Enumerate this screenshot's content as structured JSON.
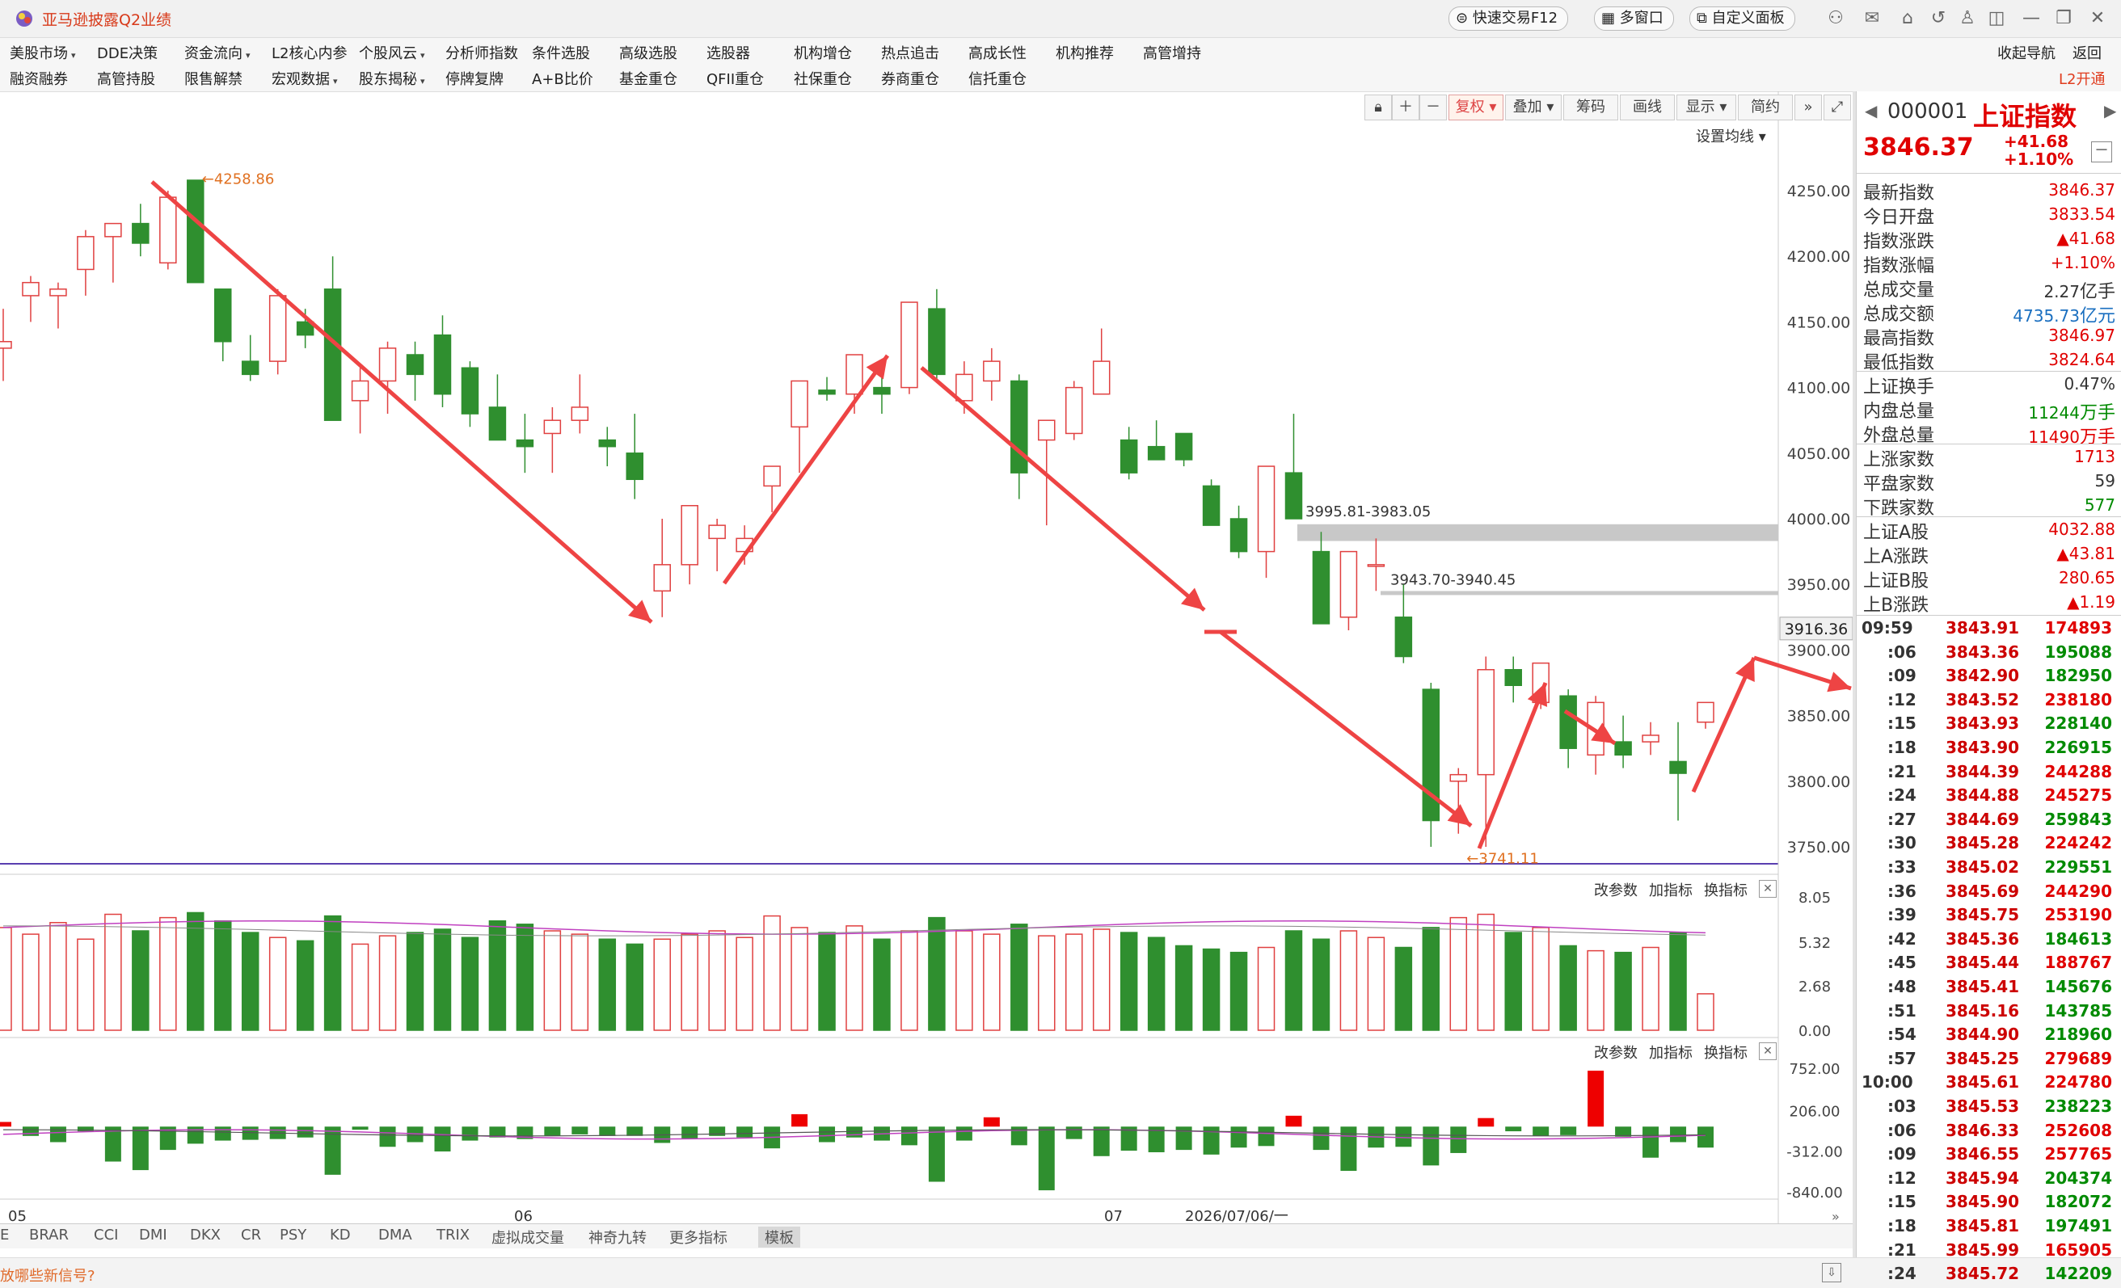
{
  "app": {
    "title": "亚马逊披露Q2业绩",
    "quick_trade": "快速交易F12",
    "multi_window": "多窗口",
    "custom_panel": "自定义面板",
    "nav": "收起导航",
    "back": "返回",
    "l2": "L2开通"
  },
  "menu_row1": [
    {
      "label": "美股市场",
      "dropdown": true
    },
    {
      "label": "DDE决策",
      "dropdown": false
    },
    {
      "label": "资金流向",
      "dropdown": true
    },
    {
      "label": "L2核心内参",
      "dropdown": false
    },
    {
      "label": "个股风云",
      "dropdown": true
    },
    {
      "label": "分析师指数",
      "dropdown": false
    },
    {
      "label": "条件选股",
      "dropdown": false
    },
    {
      "label": "高级选股",
      "dropdown": false
    },
    {
      "label": "选股器",
      "dropdown": false
    },
    {
      "label": "机构增仓",
      "dropdown": false
    },
    {
      "label": "热点追击",
      "dropdown": false
    },
    {
      "label": "高成长性",
      "dropdown": false
    },
    {
      "label": "机构推荐",
      "dropdown": false
    },
    {
      "label": "高管增持",
      "dropdown": false
    }
  ],
  "menu_row2": [
    {
      "label": "融资融券",
      "dropdown": false
    },
    {
      "label": "高管持股",
      "dropdown": false
    },
    {
      "label": "限售解禁",
      "dropdown": false
    },
    {
      "label": "宏观数据",
      "dropdown": true
    },
    {
      "label": "股东揭秘",
      "dropdown": true
    },
    {
      "label": "停牌复牌",
      "dropdown": false
    },
    {
      "label": "A+B比价",
      "dropdown": false
    },
    {
      "label": "基金重仓",
      "dropdown": false
    },
    {
      "label": "QFII重仓",
      "dropdown": false
    },
    {
      "label": "社保重仓",
      "dropdown": false
    },
    {
      "label": "券商重仓",
      "dropdown": false
    },
    {
      "label": "信托重仓",
      "dropdown": false
    }
  ],
  "toolbar": {
    "restore": "复权",
    "overlay": "叠加",
    "chips": "筹码",
    "draw": "画线",
    "display": "显示",
    "simple": "简约",
    "ma_setting": "设置均线"
  },
  "chart_data": {
    "type": "candlestick",
    "title": "",
    "price_axis": [
      "4250.00",
      "4200.00",
      "4150.00",
      "4100.00",
      "4050.00",
      "4000.00",
      "3950.00",
      "3900.00",
      "3850.00",
      "3800.00",
      "3750.00"
    ],
    "price_min": 3725,
    "price_max": 4275,
    "current_price_label": "3916.36",
    "high_marker": "←4258.86",
    "low_marker": "←3741.11",
    "gap_labels": [
      "3995.81-3983.05",
      "3943.70-3940.45"
    ],
    "x_labels": [
      "05",
      "06",
      "07",
      "2026/07/06/一"
    ],
    "candles": [
      [
        4130,
        4160,
        4105,
        4135
      ],
      [
        4170,
        4185,
        4150,
        4180
      ],
      [
        4170,
        4180,
        4145,
        4175
      ],
      [
        4190,
        4220,
        4170,
        4215
      ],
      [
        4215,
        4225,
        4180,
        4225
      ],
      [
        4225,
        4240,
        4200,
        4210
      ],
      [
        4195,
        4250,
        4190,
        4245
      ],
      [
        4258,
        4258,
        4180,
        4180
      ],
      [
        4175,
        4175,
        4120,
        4135
      ],
      [
        4120,
        4140,
        4105,
        4110
      ],
      [
        4120,
        4175,
        4110,
        4170
      ],
      [
        4150,
        4160,
        4130,
        4140
      ],
      [
        4175,
        4200,
        4075,
        4075
      ],
      [
        4090,
        4115,
        4065,
        4105
      ],
      [
        4105,
        4135,
        4080,
        4130
      ],
      [
        4125,
        4135,
        4090,
        4110
      ],
      [
        4140,
        4155,
        4085,
        4095
      ],
      [
        4115,
        4120,
        4070,
        4080
      ],
      [
        4085,
        4110,
        4060,
        4060
      ],
      [
        4060,
        4080,
        4035,
        4055
      ],
      [
        4065,
        4085,
        4035,
        4075
      ],
      [
        4075,
        4110,
        4065,
        4085
      ],
      [
        4060,
        4070,
        4040,
        4055
      ],
      [
        4050,
        4080,
        4015,
        4030
      ],
      [
        3945,
        4000,
        3925,
        3965
      ],
      [
        3965,
        4010,
        3950,
        4010
      ],
      [
        3985,
        4000,
        3960,
        3995
      ],
      [
        3975,
        3995,
        3965,
        3985
      ],
      [
        4025,
        4040,
        4005,
        4040
      ],
      [
        4070,
        4105,
        4035,
        4105
      ],
      [
        4098,
        4108,
        4090,
        4095
      ],
      [
        4095,
        4125,
        4080,
        4125
      ],
      [
        4100,
        4115,
        4080,
        4095
      ],
      [
        4100,
        4165,
        4095,
        4165
      ],
      [
        4160,
        4175,
        4105,
        4110
      ],
      [
        4090,
        4120,
        4080,
        4110
      ],
      [
        4105,
        4130,
        4090,
        4120
      ],
      [
        4105,
        4110,
        4015,
        4035
      ],
      [
        4060,
        4075,
        3995,
        4075
      ],
      [
        4065,
        4105,
        4060,
        4100
      ],
      [
        4095,
        4145,
        4095,
        4120
      ],
      [
        4060,
        4070,
        4030,
        4035
      ],
      [
        4055,
        4075,
        4045,
        4045
      ],
      [
        4065,
        4065,
        4040,
        4045
      ],
      [
        4025,
        4030,
        3995,
        3995
      ],
      [
        4000,
        4010,
        3970,
        3975
      ],
      [
        3975,
        4040,
        3955,
        4040
      ],
      [
        4035,
        4080,
        4005,
        4000
      ],
      [
        3975,
        3990,
        3920,
        3920
      ],
      [
        3925,
        3975,
        3915,
        3975
      ],
      [
        3965,
        3985,
        3945,
        3965
      ],
      [
        3925,
        3950,
        3890,
        3895
      ],
      [
        3870,
        3875,
        3750,
        3770
      ],
      [
        3800,
        3810,
        3760,
        3805
      ],
      [
        3805,
        3895,
        3750,
        3885
      ],
      [
        3885,
        3895,
        3860,
        3873
      ],
      [
        3860,
        3890,
        3855,
        3890
      ],
      [
        3865,
        3870,
        3810,
        3825
      ],
      [
        3820,
        3865,
        3805,
        3860
      ],
      [
        3830,
        3850,
        3810,
        3820
      ],
      [
        3830,
        3845,
        3820,
        3835
      ],
      [
        3815,
        3845,
        3770,
        3806
      ],
      [
        3845,
        3860,
        3840,
        3860
      ]
    ],
    "vol_axis": [
      "8.05",
      "5.32",
      "2.68",
      "0.00"
    ],
    "macd_axis": [
      "752.00",
      "206.00",
      "-312.00",
      "-840.00"
    ]
  },
  "indicator_controls": {
    "modify": "改参数",
    "add": "加指标",
    "switch": "换指标"
  },
  "bottom_tabs": [
    "E",
    "BRAR",
    "CCI",
    "DMI",
    "DKX",
    "CR",
    "PSY",
    "KD",
    "DMA",
    "TRIX",
    "虚拟成交量",
    "神奇九转",
    "更多指标",
    "模板"
  ],
  "status_msg": "放哪些新信号?",
  "quote": {
    "code": "000001",
    "name": "上证指数",
    "price": "3846.37",
    "change": "+41.68",
    "change_pct": "+1.10%",
    "rows": [
      {
        "label": "最新指数",
        "value": "3846.37",
        "color": "red",
        "unit": ""
      },
      {
        "label": "今日开盘",
        "value": "3833.54",
        "color": "red",
        "unit": ""
      },
      {
        "label": "指数涨跌",
        "value": "▲41.68",
        "color": "red",
        "unit": ""
      },
      {
        "label": "指数涨幅",
        "value": "+1.10%",
        "color": "red",
        "unit": ""
      },
      {
        "label": "总成交量",
        "value": "2.27",
        "color": "black",
        "unit": "亿手"
      },
      {
        "label": "总成交额",
        "value": "4735.73",
        "color": "blue",
        "unit": "亿元"
      },
      {
        "label": "最高指数",
        "value": "3846.97",
        "color": "red",
        "unit": ""
      },
      {
        "label": "最低指数",
        "value": "3824.64",
        "color": "red",
        "unit": ""
      },
      {
        "label": "上证换手",
        "value": "0.47%",
        "color": "black",
        "unit": ""
      },
      {
        "label": "内盘总量",
        "value": "11244",
        "color": "green",
        "unit": "万手"
      },
      {
        "label": "外盘总量",
        "value": "11490",
        "color": "red",
        "unit": "万手"
      },
      {
        "label": "上涨家数",
        "value": "1713",
        "color": "red",
        "unit": ""
      },
      {
        "label": "平盘家数",
        "value": "59",
        "color": "black",
        "unit": ""
      },
      {
        "label": "下跌家数",
        "value": "577",
        "color": "green",
        "unit": ""
      },
      {
        "label": "上证A股",
        "value": "4032.88",
        "color": "red",
        "unit": ""
      },
      {
        "label": "上A涨跌",
        "value": "▲43.81",
        "color": "red",
        "unit": ""
      },
      {
        "label": "上证B股",
        "value": "280.65",
        "color": "red",
        "unit": ""
      },
      {
        "label": "上B涨跌",
        "value": "▲1.19",
        "color": "red",
        "unit": ""
      }
    ],
    "ticks": [
      [
        "09:59",
        "3843.91",
        "174893",
        "red"
      ],
      [
        ":06",
        "3843.36",
        "195088",
        "green"
      ],
      [
        ":09",
        "3842.90",
        "182950",
        "green"
      ],
      [
        ":12",
        "3843.52",
        "238180",
        "red"
      ],
      [
        ":15",
        "3843.93",
        "228140",
        "green"
      ],
      [
        ":18",
        "3843.90",
        "226915",
        "green"
      ],
      [
        ":21",
        "3844.39",
        "244288",
        "red"
      ],
      [
        ":24",
        "3844.88",
        "245275",
        "red"
      ],
      [
        ":27",
        "3844.69",
        "259843",
        "green"
      ],
      [
        ":30",
        "3845.28",
        "224242",
        "red"
      ],
      [
        ":33",
        "3845.02",
        "229551",
        "green"
      ],
      [
        ":36",
        "3845.69",
        "244290",
        "red"
      ],
      [
        ":39",
        "3845.75",
        "253190",
        "red"
      ],
      [
        ":42",
        "3845.36",
        "184613",
        "green"
      ],
      [
        ":45",
        "3845.44",
        "188767",
        "red"
      ],
      [
        ":48",
        "3845.41",
        "145676",
        "green"
      ],
      [
        ":51",
        "3845.16",
        "143785",
        "green"
      ],
      [
        ":54",
        "3844.90",
        "218960",
        "green"
      ],
      [
        ":57",
        "3845.25",
        "279689",
        "red"
      ],
      [
        "10:00",
        "3845.61",
        "224780",
        "red"
      ],
      [
        ":03",
        "3845.53",
        "238223",
        "green"
      ],
      [
        ":06",
        "3846.33",
        "252608",
        "red"
      ],
      [
        ":09",
        "3846.55",
        "257765",
        "red"
      ],
      [
        ":12",
        "3845.94",
        "204374",
        "green"
      ],
      [
        ":15",
        "3845.90",
        "182072",
        "green"
      ],
      [
        ":18",
        "3845.81",
        "197491",
        "green"
      ],
      [
        ":21",
        "3845.99",
        "165905",
        "red"
      ],
      [
        ":24",
        "3845.72",
        "142209",
        "green"
      ]
    ]
  }
}
